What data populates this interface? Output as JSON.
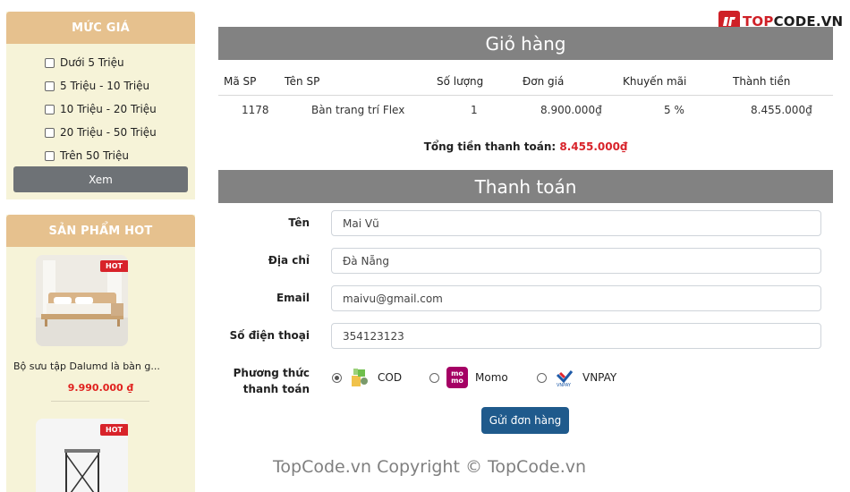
{
  "logo": {
    "text_accent": "TOP",
    "text_rest": "CODE.VN"
  },
  "sidebar": {
    "price_filter": {
      "title": "MỨC GIÁ",
      "options": [
        {
          "label": "Dưới 5 Triệu",
          "checked": false
        },
        {
          "label": "5 Triệu - 10 Triệu",
          "checked": false
        },
        {
          "label": "10 Triệu - 20 Triệu",
          "checked": false
        },
        {
          "label": "20 Triệu - 50 Triệu",
          "checked": false
        },
        {
          "label": "Trên 50 Triệu",
          "checked": false
        }
      ],
      "button_label": "Xem"
    },
    "hot_products": {
      "title": "SẢN PHẨM HOT",
      "items": [
        {
          "badge": "HOT",
          "name": "Bộ sưu tập Dalumd là bàn g...",
          "price": "9.990.000 ₫"
        },
        {
          "badge": "HOT"
        }
      ]
    }
  },
  "cart": {
    "title": "Giỏ hàng",
    "columns": [
      "Mã SP",
      "Tên SP",
      "Số lượng",
      "Đơn giá",
      "Khuyến mãi",
      "Thành tiền"
    ],
    "rows": [
      [
        "1178",
        "Bàn trang trí Flex",
        "1",
        "8.900.000₫",
        "5 %",
        "8.455.000₫"
      ]
    ],
    "total_label": "Tổng tiền thanh toán:",
    "total_value": "8.455.000₫"
  },
  "payment": {
    "title": "Thanh toán",
    "fields": {
      "name": {
        "label": "Tên",
        "value": "Mai Vũ"
      },
      "address": {
        "label": "Địa chỉ",
        "value": "Đà Nẵng"
      },
      "email": {
        "label": "Email",
        "value": "maivu@gmail.com"
      },
      "phone": {
        "label": "Số điện thoại",
        "value": "354123123"
      }
    },
    "method_label_line1": "Phương thức",
    "method_label_line2": "thanh toán",
    "methods": [
      {
        "label": "COD",
        "icon": "cod-icon",
        "selected": true
      },
      {
        "label": "Momo",
        "icon": "momo-icon",
        "selected": false
      },
      {
        "label": "VNPAY",
        "icon": "vnpay-icon",
        "selected": false
      }
    ],
    "submit_label": "Gửi đơn hàng"
  },
  "watermark": "TopCode.vn  Copyright © TopCode.vn",
  "colors": {
    "panel_header": "#e6c18e",
    "panel_bg": "#f6f3d8",
    "section_title_bg": "#828282",
    "price_red": "#e0221f",
    "submit_blue": "#1f5a8c",
    "hot_badge": "#d8232a"
  }
}
